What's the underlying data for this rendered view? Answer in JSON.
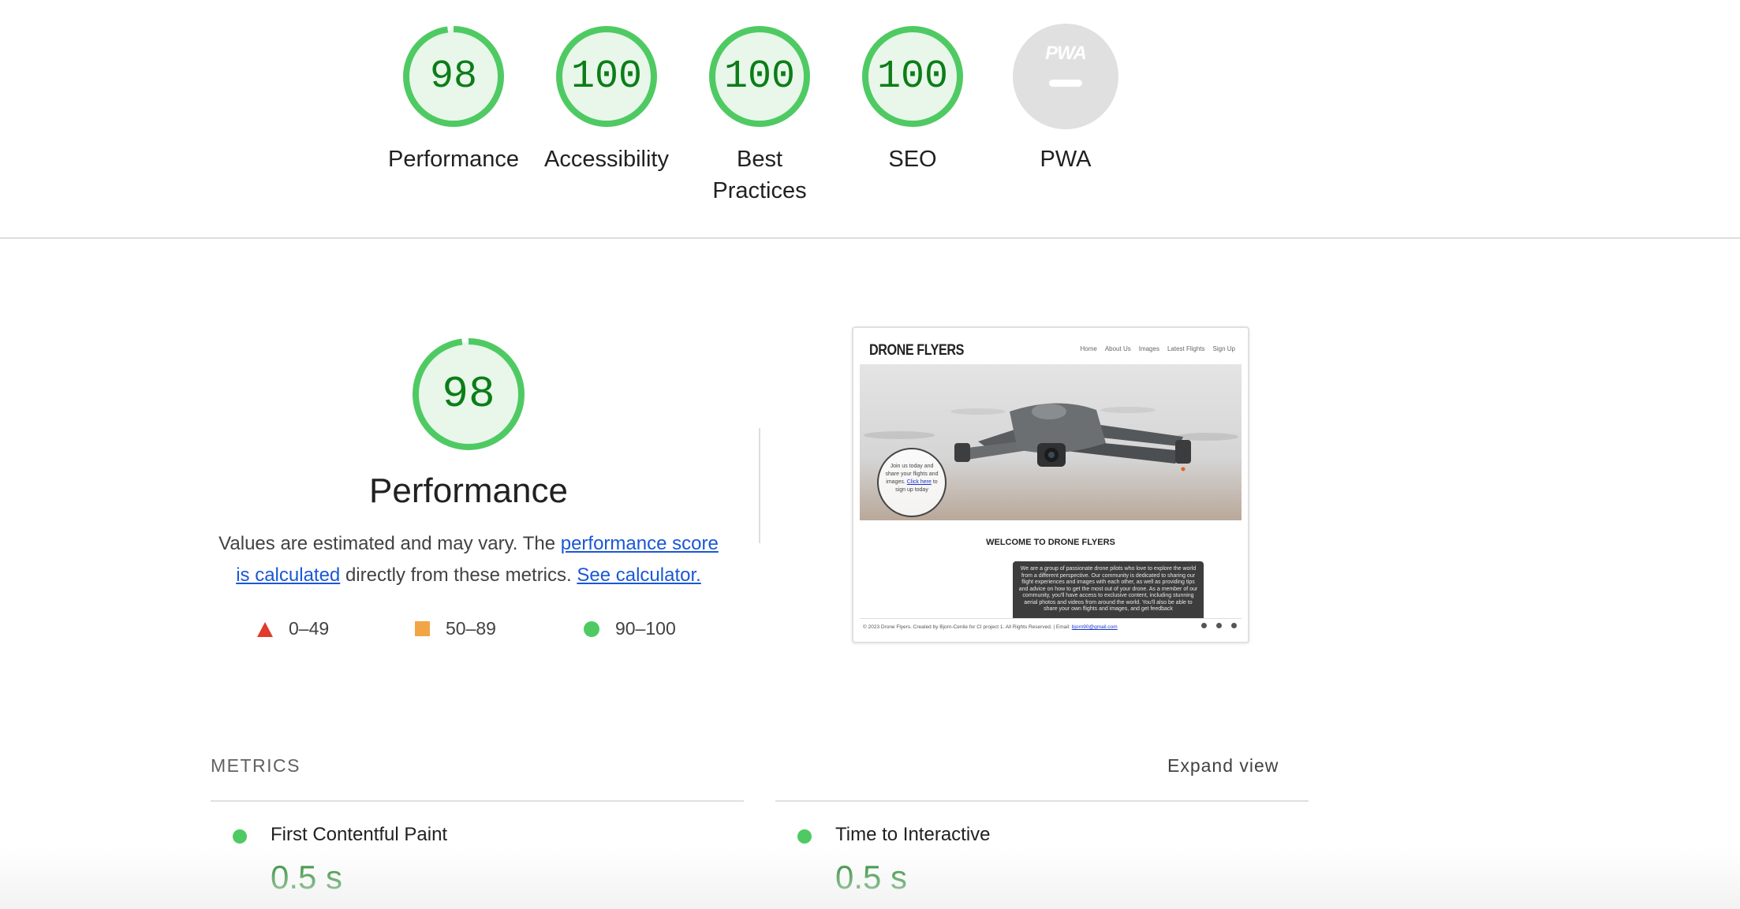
{
  "categories": [
    {
      "score": "98",
      "score_fraction": 0.98,
      "label": "Performance"
    },
    {
      "score": "100",
      "score_fraction": 1.0,
      "label": "Accessibility"
    },
    {
      "score": "100",
      "score_fraction": 1.0,
      "label_line1": "Best",
      "label_line2": "Practices"
    },
    {
      "score": "100",
      "score_fraction": 1.0,
      "label": "SEO"
    },
    {
      "badge_text": "PWA",
      "label": "PWA"
    }
  ],
  "performance": {
    "score": "98",
    "score_fraction": 0.98,
    "title": "Performance",
    "desc_prefix": "Values are estimated and may vary. The ",
    "desc_link": "performance score is calculated",
    "desc_middle": " directly from these metrics. ",
    "calc_link": "See calculator.",
    "legend": [
      {
        "symbol": "triangle",
        "range": "0–49"
      },
      {
        "symbol": "square",
        "range": "50–89"
      },
      {
        "symbol": "circle",
        "range": "90–100"
      }
    ]
  },
  "screenshot": {
    "site_logo": "DRONE FLYERS",
    "nav": [
      "Home",
      "About Us",
      "Images",
      "Latest Flights",
      "Sign Up"
    ],
    "hero_text": "Join us today and share your flights and images.",
    "hero_link": "Click here",
    "hero_suffix": "to sign up today",
    "welcome": "WELCOME TO DRONE FLYERS",
    "body_text": "We are a group of passionate drone pilots who love to explore the world from a different perspective. Our community is dedicated to sharing our flight experiences and images with each other, as well as providing tips and advice on how to get the most out of your drone. As a member of our community, you'll have access to exclusive content, including stunning aerial photos and videos from around the world. You'll also be able to share your own flights and images, and get feedback",
    "footer_text": "© 2023 Drone Flyers. Created by Bjorn-Cenlie for CI project 1. All Rights Reserved. | Email:",
    "footer_email": "bjorn90@gmail.com"
  },
  "metrics": {
    "title": "METRICS",
    "expand": "Expand view",
    "items": [
      {
        "label": "First Contentful Paint",
        "value": "0.5 s"
      },
      {
        "label": "Time to Interactive",
        "value": "0.5 s"
      }
    ]
  },
  "colors": {
    "pass": "#0c7d18",
    "pass_ring": "#4fca63",
    "pass_bg": "#e8f7ea",
    "average": "#f2a544",
    "fail": "#e03b2e",
    "link": "#1a57d6"
  }
}
